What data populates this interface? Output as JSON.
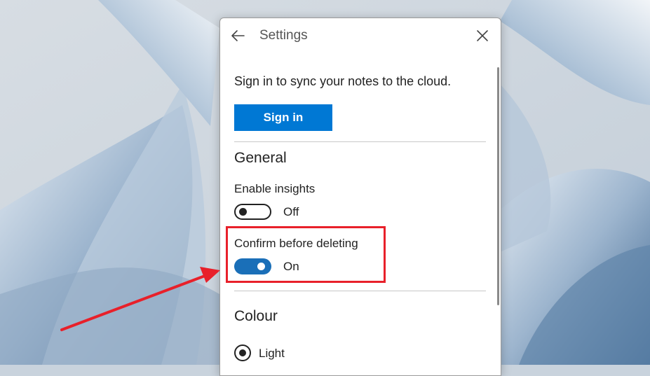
{
  "window": {
    "title": "Settings",
    "back_icon": "arrow-left-icon",
    "close_icon": "close-icon"
  },
  "sync": {
    "text": "Sign in to sync your notes to the cloud.",
    "button_label": "Sign in"
  },
  "general": {
    "heading": "General",
    "insights": {
      "label": "Enable insights",
      "state": "Off",
      "checked": false
    },
    "confirm_delete": {
      "label": "Confirm before deleting",
      "state": "On",
      "checked": true
    }
  },
  "colour": {
    "heading": "Colour",
    "options": [
      {
        "label": "Light",
        "selected": true
      }
    ]
  },
  "colors": {
    "accent": "#0078d4",
    "toggle_on": "#1a6fb8",
    "annotation": "#e8202a"
  }
}
